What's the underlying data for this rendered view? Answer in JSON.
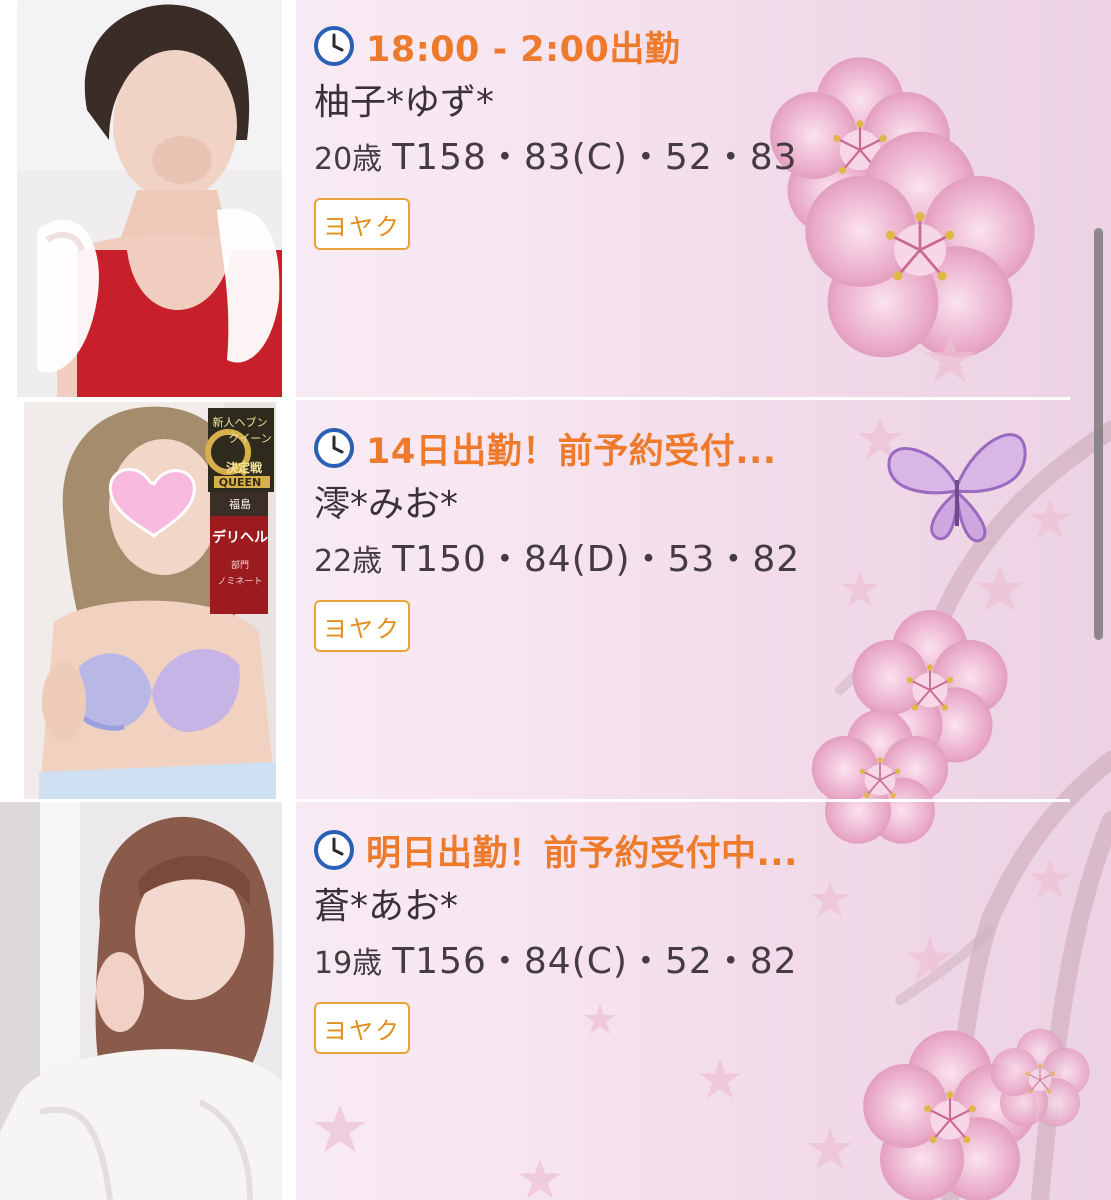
{
  "colors": {
    "accent_orange": "#ee7a2c",
    "button_border": "#e8a43a",
    "text_dark": "#3a3236"
  },
  "cards": [
    {
      "photo_icon": "profile-photo",
      "clock_icon": "clock-icon",
      "status": "18:00 - 2:00出勤",
      "name": "柚子*ゆず*",
      "age": "20歳",
      "measurements": "T158・83(C)・52・83",
      "reserve_label": "ヨヤク"
    },
    {
      "photo_icon": "profile-photo",
      "clock_icon": "clock-icon",
      "status": "14日出勤！前予約受付...",
      "name": "澪*みお*",
      "age": "22歳",
      "measurements": "T150・84(D)・53・82",
      "reserve_label": "ヨヤク",
      "badge_lines": [
        "新人ヘブン",
        "クイーン",
        "QUEEN",
        "決定戦",
        "福島",
        "デリヘル",
        "部門",
        "ノミネート"
      ]
    },
    {
      "photo_icon": "profile-photo",
      "clock_icon": "clock-icon",
      "status": "明日出勤！前予約受付中...",
      "name": "蒼*あお*",
      "age": "19歳",
      "measurements": "T156・84(C)・52・82",
      "reserve_label": "ヨヤク"
    }
  ]
}
